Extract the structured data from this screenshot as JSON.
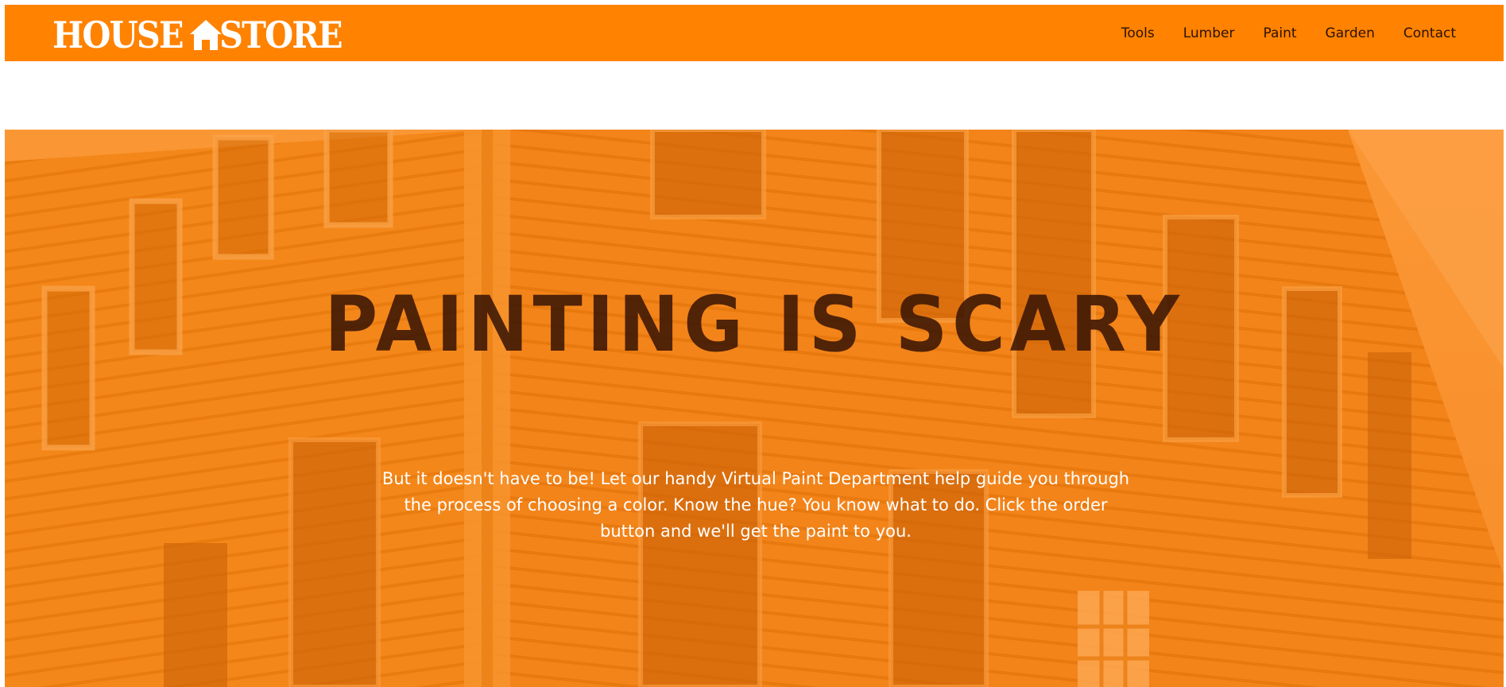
{
  "header": {
    "logo_left": "HOUSE",
    "logo_right": "STORE",
    "logo_icon": "house-icon",
    "brand_color": "#ff8200"
  },
  "nav": {
    "items": [
      {
        "label": "Tools"
      },
      {
        "label": "Lumber"
      },
      {
        "label": "Paint"
      },
      {
        "label": "Garden"
      },
      {
        "label": "Contact"
      }
    ]
  },
  "hero": {
    "title": "PAINTING IS SCARY",
    "text": "But it doesn't have to be! Let our handy Virtual Paint Department help guide you through the process of choosing a color. Know the hue? You know what to do. Click the order button and we'll get the paint to you.",
    "overlay_color": "#ff8200",
    "title_color": "#3a1604",
    "text_color": "#ffffff"
  }
}
